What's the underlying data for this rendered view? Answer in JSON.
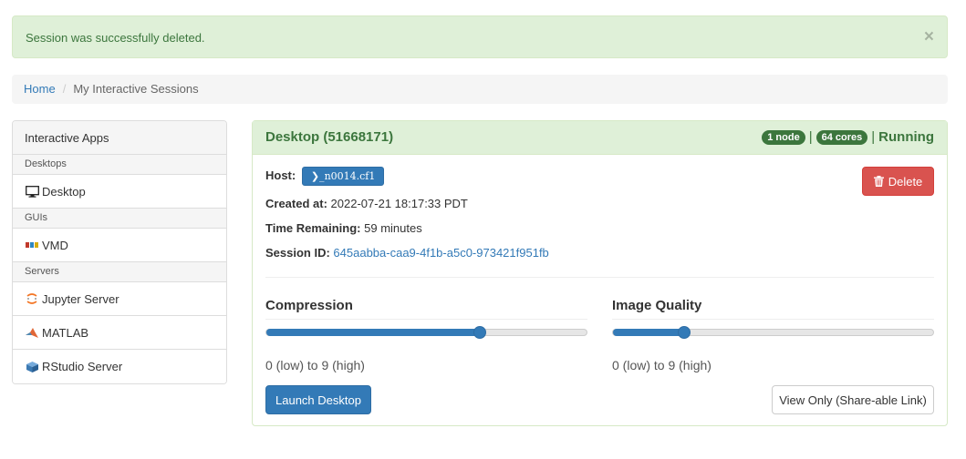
{
  "alert": {
    "message": "Session was successfully deleted.",
    "close": "×",
    "color": "#3c763d"
  },
  "breadcrumb": {
    "home": "Home",
    "current": "My Interactive Sessions",
    "separator": "/"
  },
  "sidebar": {
    "header": "Interactive Apps",
    "categories": [
      {
        "label": "Desktops",
        "items": [
          {
            "label": "Desktop",
            "icon": "monitor-icon"
          }
        ]
      },
      {
        "label": "GUIs",
        "items": [
          {
            "label": "VMD",
            "icon": "vmd-logo-icon"
          }
        ]
      },
      {
        "label": "Servers",
        "items": [
          {
            "label": "Jupyter Server",
            "icon": "jupyter-logo-icon"
          },
          {
            "label": "MATLAB",
            "icon": "matlab-logo-icon"
          },
          {
            "label": "RStudio Server",
            "icon": "rstudio-logo-icon"
          }
        ]
      }
    ]
  },
  "session": {
    "title": "Desktop (51668171)",
    "nodes_badge": "1 node",
    "cores_badge": "64 cores",
    "separator": "|",
    "status": "Running",
    "host_label": "Host:",
    "host_value": "n0014.cf1",
    "host_prompt": "❯_",
    "created_label": "Created at:",
    "created_value": "2022-07-21 18:17:33 PDT",
    "time_label": "Time Remaining:",
    "time_value": "59 minutes",
    "id_label": "Session ID:",
    "id_value": "645aabba-caa9-4f1b-a5c0-973421f951fb",
    "delete_label": "Delete",
    "compression": {
      "label": "Compression",
      "value": 6,
      "min": 0,
      "max": 9,
      "help": "0 (low) to 9 (high)"
    },
    "quality": {
      "label": "Image Quality",
      "value": 2,
      "min": 0,
      "max": 9,
      "help": "0 (low) to 9 (high)"
    },
    "launch_label": "Launch Desktop",
    "view_only_label": "View Only (Share-able Link)"
  },
  "colors": {
    "primary": "#337ab7",
    "success": "#3c763d",
    "danger": "#d9534f"
  }
}
